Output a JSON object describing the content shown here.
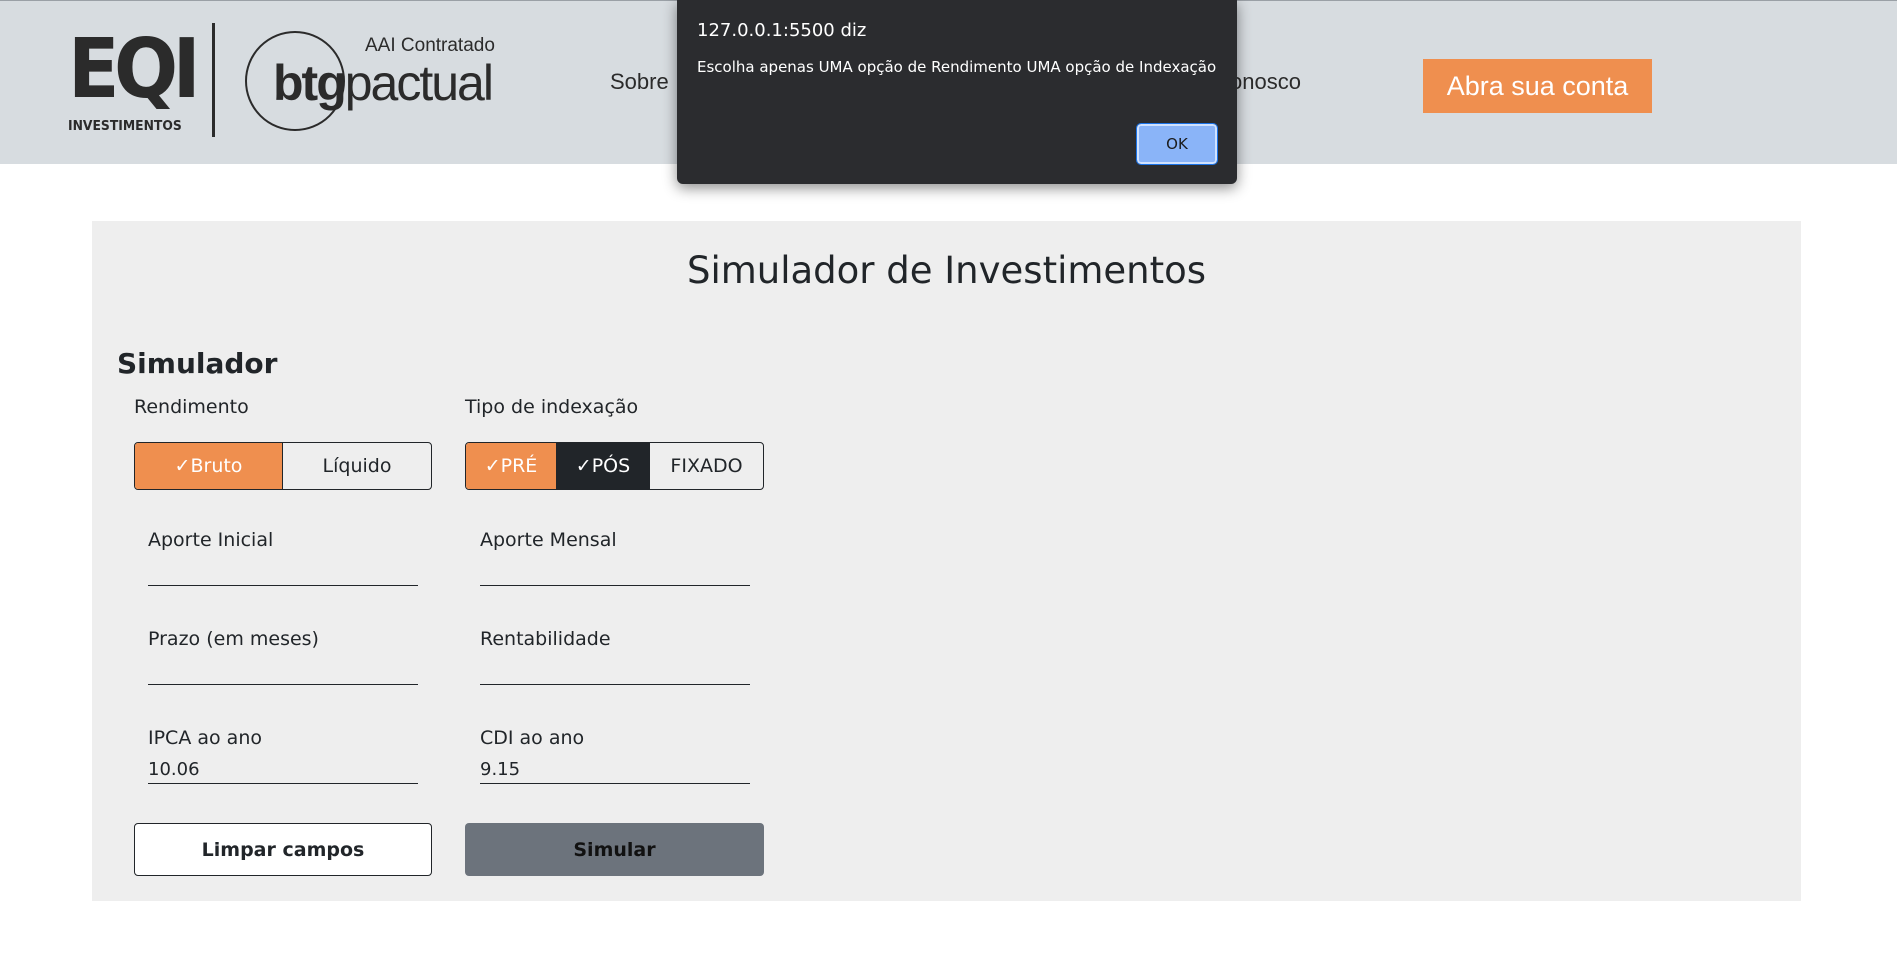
{
  "header": {
    "eqi_logo": {
      "letters": "EQI",
      "sub": "INVESTIMENTOS"
    },
    "btg_logo": {
      "tagline": "AAI Contratado",
      "bold": "btg",
      "light": "pactual"
    },
    "nav": [
      "Sobre",
      "onosco"
    ],
    "cta_label": "Abra sua conta"
  },
  "main": {
    "title": "Simulador de Investimentos",
    "section_title": "Simulador",
    "rendimento": {
      "label": "Rendimento",
      "options": [
        "✓Bruto",
        "Líquido"
      ]
    },
    "indexacao": {
      "label": "Tipo de indexação",
      "options": [
        "✓PRÉ",
        "✓PÓS",
        "FIXADO"
      ]
    },
    "fields": {
      "aporte_inicial": {
        "label": "Aporte Inicial",
        "value": ""
      },
      "aporte_mensal": {
        "label": "Aporte Mensal",
        "value": ""
      },
      "prazo": {
        "label": "Prazo (em meses)",
        "value": ""
      },
      "rentabilidade": {
        "label": "Rentabilidade",
        "value": ""
      },
      "ipca": {
        "label": "IPCA ao ano",
        "value": "10.06"
      },
      "cdi": {
        "label": "CDI ao ano",
        "value": "9.15"
      }
    },
    "buttons": {
      "clear": "Limpar campos",
      "simulate": "Simular"
    }
  },
  "alert": {
    "title": "127.0.0.1:5500 diz",
    "message": "Escolha apenas UMA opção de Rendimento UMA opção de Indexação",
    "ok_label": "OK"
  },
  "colors": {
    "accent_orange": "#ef8f4f",
    "dark": "#212529",
    "header_bg": "#d7dce0",
    "panel_bg": "#eeeeee",
    "simulate_button": "#6c737c"
  }
}
